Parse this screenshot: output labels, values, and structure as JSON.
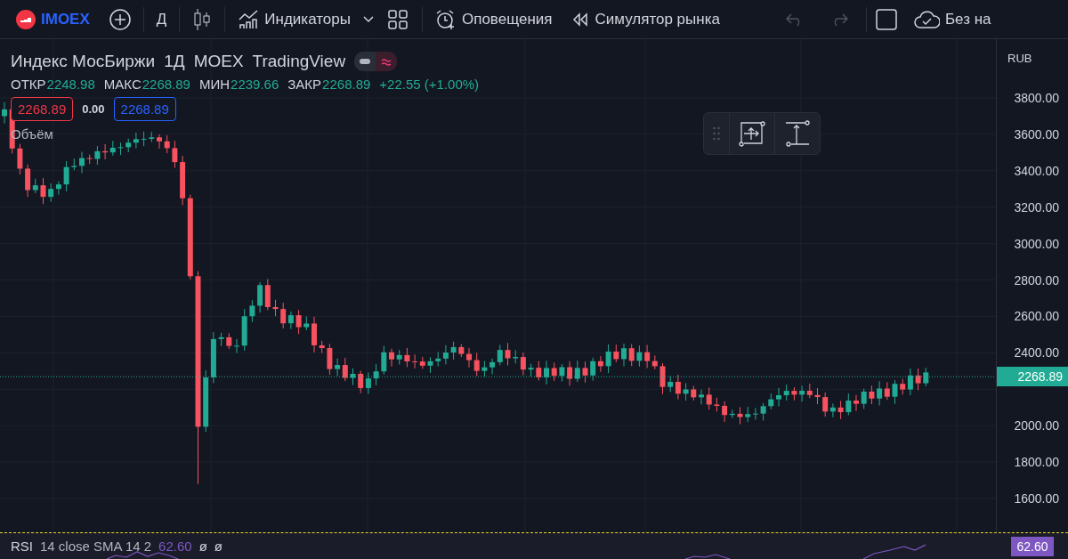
{
  "toolbar": {
    "symbol": "IMOEX",
    "interval": "Д",
    "indicators": "Индикаторы",
    "alerts": "Оповещения",
    "replay": "Симулятор рынка",
    "save": "Без на"
  },
  "legend": {
    "title": "Индекс МосБиржи",
    "interval": "1Д",
    "exchange": "MOEX",
    "source": "TradingView",
    "ohlc": [
      {
        "label": "ОТКР",
        "value": "2248.98"
      },
      {
        "label": "МАКС",
        "value": "2268.89"
      },
      {
        "label": "МИН",
        "value": "2239.66"
      },
      {
        "label": "ЗАКР",
        "value": "2268.89"
      }
    ],
    "change": "+22.55 (+1.00%)",
    "sell": "2268.89",
    "spread": "0.00",
    "buy": "2268.89",
    "volume": "Объём"
  },
  "price_scale": {
    "currency": "RUB",
    "labels": [
      "3800.00",
      "3600.00",
      "3400.00",
      "3200.00",
      "3000.00",
      "2800.00",
      "2600.00",
      "2400.00",
      "2000.00",
      "1800.00",
      "1600.00"
    ],
    "last_price": "2268.89"
  },
  "rsi": {
    "name": "RSI",
    "params": "14 close SMA 14 2",
    "value": "62.60",
    "extra": [
      "ø",
      "ø"
    ],
    "badge": "62.60"
  }
}
